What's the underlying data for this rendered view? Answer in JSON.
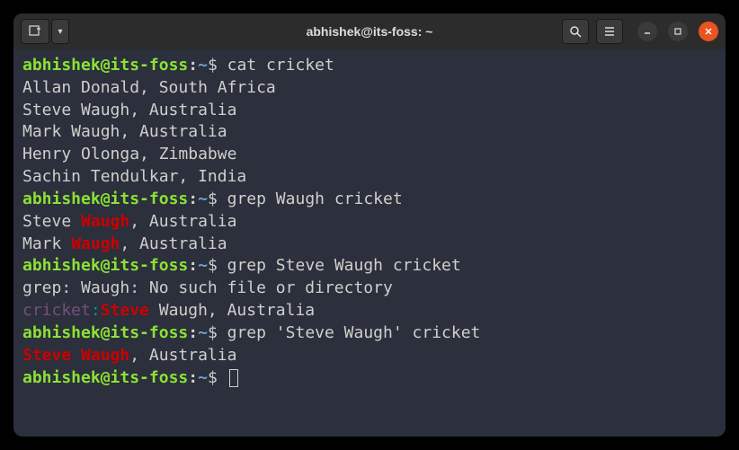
{
  "window": {
    "title": "abhishek@its-foss: ~"
  },
  "prompt": {
    "user": "abhishek",
    "at": "@",
    "host": "its-foss",
    "colon": ":",
    "path": "~",
    "dollar": "$ "
  },
  "lines": {
    "cmd1": "cat cricket",
    "out1": "Allan Donald, South Africa",
    "out2": "Steve Waugh, Australia",
    "out3": "Mark Waugh, Australia",
    "out4": "Henry Olonga, Zimbabwe",
    "out5": "Sachin Tendulkar, India",
    "cmd2": "grep Waugh cricket",
    "m2a_pre": "Steve ",
    "m2a_match": "Waugh",
    "m2a_post": ", Australia",
    "m2b_pre": "Mark ",
    "m2b_match": "Waugh",
    "m2b_post": ", Australia",
    "cmd3": "grep Steve Waugh cricket",
    "err3": "grep: Waugh: No such file or directory",
    "m3_file": "cricket",
    "m3_colon": ":",
    "m3_match": "Steve",
    "m3_post": " Waugh, Australia",
    "cmd4": "grep 'Steve Waugh' cricket",
    "m4_match": "Steve Waugh",
    "m4_post": ", Australia"
  }
}
